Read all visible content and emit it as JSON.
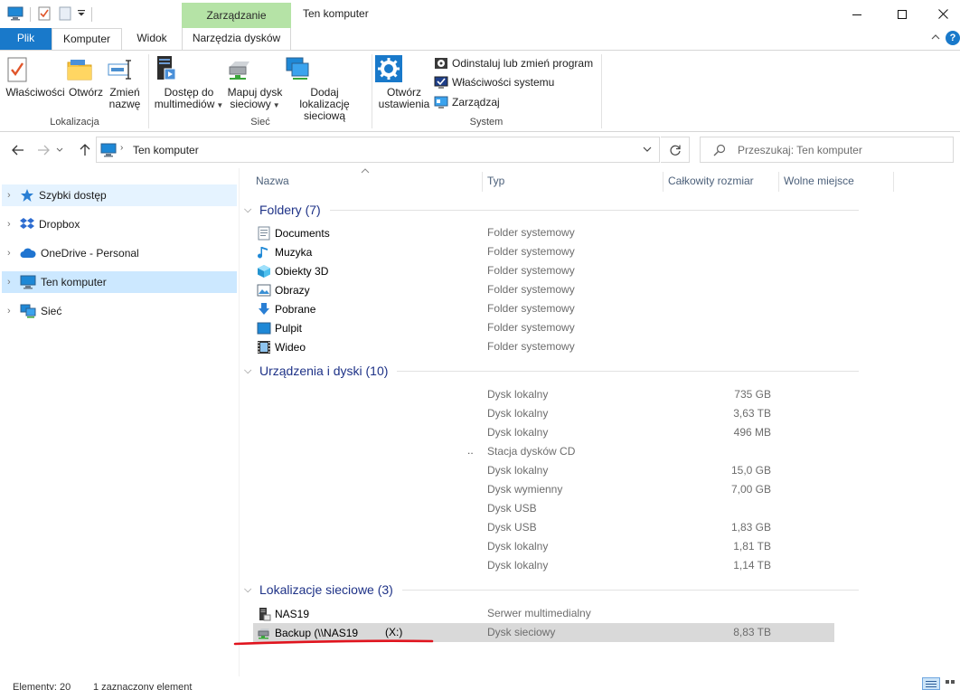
{
  "window": {
    "title": "Ten komputer"
  },
  "contextual": {
    "header": "Zarządzanie"
  },
  "tabs": {
    "file": "Plik",
    "computer": "Komputer",
    "view": "Widok",
    "drive_tools": "Narzędzia dysków"
  },
  "ribbon": {
    "location": {
      "properties": "Właściwości",
      "open": "Otwórz",
      "rename_line1": "Zmień",
      "rename_line2": "nazwę",
      "group_label": "Lokalizacja"
    },
    "network": {
      "media_line1": "Dostęp do",
      "media_line2": "multimediów",
      "map_line1": "Mapuj dysk",
      "map_line2": "sieciowy",
      "add_line1": "Dodaj lokalizację",
      "add_line2": "sieciową",
      "group_label": "Sieć"
    },
    "system": {
      "settings_line1": "Otwórz",
      "settings_line2": "ustawienia",
      "uninstall": "Odinstaluj lub zmień program",
      "sysprops": "Właściwości systemu",
      "manage": "Zarządzaj",
      "group_label": "System"
    }
  },
  "address": {
    "path": "Ten komputer",
    "search_placeholder": "Przeszukaj: Ten komputer"
  },
  "nav": [
    {
      "label": "Szybki dostęp"
    },
    {
      "label": "Dropbox"
    },
    {
      "label": "OneDrive - Personal"
    },
    {
      "label": "Ten komputer"
    },
    {
      "label": "Sieć"
    }
  ],
  "columns": {
    "name": "Nazwa",
    "type": "Typ",
    "total": "Całkowity rozmiar",
    "free": "Wolne miejsce"
  },
  "groups": {
    "folders": "Foldery (7)",
    "devices": "Urządzenia i dyski (10)",
    "network": "Lokalizacje sieciowe (3)"
  },
  "folders": [
    {
      "name": "Documents",
      "type": "Folder systemowy",
      "icon": "document-folder-icon"
    },
    {
      "name": "Muzyka",
      "type": "Folder systemowy",
      "icon": "music-folder-icon"
    },
    {
      "name": "Obiekty 3D",
      "type": "Folder systemowy",
      "icon": "3d-objects-icon"
    },
    {
      "name": "Obrazy",
      "type": "Folder systemowy",
      "icon": "pictures-folder-icon"
    },
    {
      "name": "Pobrane",
      "type": "Folder systemowy",
      "icon": "downloads-folder-icon"
    },
    {
      "name": "Pulpit",
      "type": "Folder systemowy",
      "icon": "desktop-folder-icon"
    },
    {
      "name": "Wideo",
      "type": "Folder systemowy",
      "icon": "video-folder-icon"
    }
  ],
  "devices": [
    {
      "type": "Dysk lokalny",
      "size": "735 GB"
    },
    {
      "type": "Dysk lokalny",
      "size": "3,63 TB"
    },
    {
      "type": "Dysk lokalny",
      "size": "496 MB"
    },
    {
      "type": "Stacja dysków CD",
      "size": "",
      "dots": ".."
    },
    {
      "type": "Dysk lokalny",
      "size": "15,0 GB"
    },
    {
      "type": "Dysk wymienny",
      "size": "7,00 GB"
    },
    {
      "type": "Dysk USB",
      "size": ""
    },
    {
      "type": "Dysk USB",
      "size": "1,83 GB"
    },
    {
      "type": "Dysk lokalny",
      "size": "1,81 TB"
    },
    {
      "type": "Dysk lokalny",
      "size": "1,14 TB"
    }
  ],
  "network_items": [
    {
      "name": "NAS19",
      "type": "Serwer multimedialny",
      "size": ""
    },
    {
      "name": "Backup (\\\\NAS19",
      "letter": "(X:)",
      "type": "Dysk sieciowy",
      "size": "8,83 TB"
    }
  ],
  "status": {
    "count": "Elementy: 20",
    "selected": "1 zaznaczony element"
  },
  "colors": {
    "accent": "#1979ca",
    "selection": "#cce8ff",
    "contextual": "#b5e3a6",
    "annotation_red": "#e0141e"
  }
}
